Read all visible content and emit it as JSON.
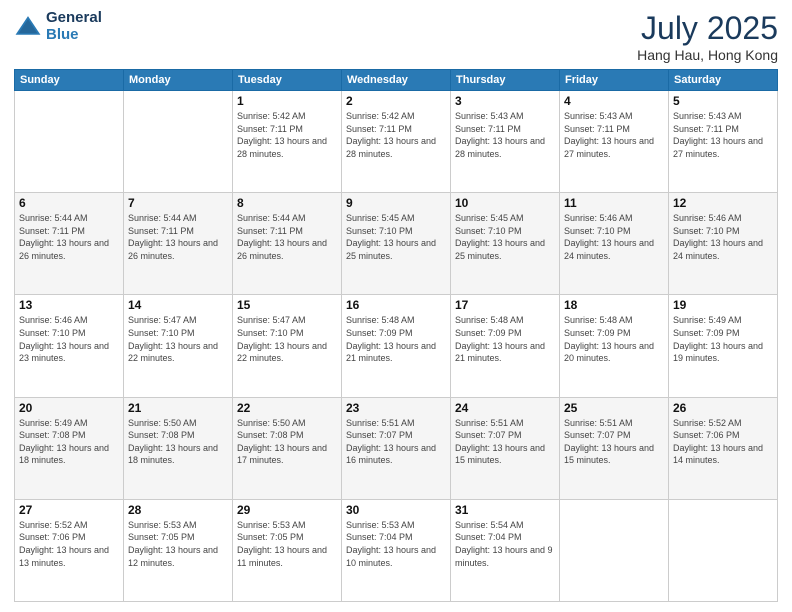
{
  "logo": {
    "general": "General",
    "blue": "Blue"
  },
  "title": {
    "month": "July 2025",
    "location": "Hang Hau, Hong Kong"
  },
  "weekdays": [
    "Sunday",
    "Monday",
    "Tuesday",
    "Wednesday",
    "Thursday",
    "Friday",
    "Saturday"
  ],
  "weeks": [
    [
      {
        "day": "",
        "info": ""
      },
      {
        "day": "",
        "info": ""
      },
      {
        "day": "1",
        "info": "Sunrise: 5:42 AM\nSunset: 7:11 PM\nDaylight: 13 hours and 28 minutes."
      },
      {
        "day": "2",
        "info": "Sunrise: 5:42 AM\nSunset: 7:11 PM\nDaylight: 13 hours and 28 minutes."
      },
      {
        "day": "3",
        "info": "Sunrise: 5:43 AM\nSunset: 7:11 PM\nDaylight: 13 hours and 28 minutes."
      },
      {
        "day": "4",
        "info": "Sunrise: 5:43 AM\nSunset: 7:11 PM\nDaylight: 13 hours and 27 minutes."
      },
      {
        "day": "5",
        "info": "Sunrise: 5:43 AM\nSunset: 7:11 PM\nDaylight: 13 hours and 27 minutes."
      }
    ],
    [
      {
        "day": "6",
        "info": "Sunrise: 5:44 AM\nSunset: 7:11 PM\nDaylight: 13 hours and 26 minutes."
      },
      {
        "day": "7",
        "info": "Sunrise: 5:44 AM\nSunset: 7:11 PM\nDaylight: 13 hours and 26 minutes."
      },
      {
        "day": "8",
        "info": "Sunrise: 5:44 AM\nSunset: 7:11 PM\nDaylight: 13 hours and 26 minutes."
      },
      {
        "day": "9",
        "info": "Sunrise: 5:45 AM\nSunset: 7:10 PM\nDaylight: 13 hours and 25 minutes."
      },
      {
        "day": "10",
        "info": "Sunrise: 5:45 AM\nSunset: 7:10 PM\nDaylight: 13 hours and 25 minutes."
      },
      {
        "day": "11",
        "info": "Sunrise: 5:46 AM\nSunset: 7:10 PM\nDaylight: 13 hours and 24 minutes."
      },
      {
        "day": "12",
        "info": "Sunrise: 5:46 AM\nSunset: 7:10 PM\nDaylight: 13 hours and 24 minutes."
      }
    ],
    [
      {
        "day": "13",
        "info": "Sunrise: 5:46 AM\nSunset: 7:10 PM\nDaylight: 13 hours and 23 minutes."
      },
      {
        "day": "14",
        "info": "Sunrise: 5:47 AM\nSunset: 7:10 PM\nDaylight: 13 hours and 22 minutes."
      },
      {
        "day": "15",
        "info": "Sunrise: 5:47 AM\nSunset: 7:10 PM\nDaylight: 13 hours and 22 minutes."
      },
      {
        "day": "16",
        "info": "Sunrise: 5:48 AM\nSunset: 7:09 PM\nDaylight: 13 hours and 21 minutes."
      },
      {
        "day": "17",
        "info": "Sunrise: 5:48 AM\nSunset: 7:09 PM\nDaylight: 13 hours and 21 minutes."
      },
      {
        "day": "18",
        "info": "Sunrise: 5:48 AM\nSunset: 7:09 PM\nDaylight: 13 hours and 20 minutes."
      },
      {
        "day": "19",
        "info": "Sunrise: 5:49 AM\nSunset: 7:09 PM\nDaylight: 13 hours and 19 minutes."
      }
    ],
    [
      {
        "day": "20",
        "info": "Sunrise: 5:49 AM\nSunset: 7:08 PM\nDaylight: 13 hours and 18 minutes."
      },
      {
        "day": "21",
        "info": "Sunrise: 5:50 AM\nSunset: 7:08 PM\nDaylight: 13 hours and 18 minutes."
      },
      {
        "day": "22",
        "info": "Sunrise: 5:50 AM\nSunset: 7:08 PM\nDaylight: 13 hours and 17 minutes."
      },
      {
        "day": "23",
        "info": "Sunrise: 5:51 AM\nSunset: 7:07 PM\nDaylight: 13 hours and 16 minutes."
      },
      {
        "day": "24",
        "info": "Sunrise: 5:51 AM\nSunset: 7:07 PM\nDaylight: 13 hours and 15 minutes."
      },
      {
        "day": "25",
        "info": "Sunrise: 5:51 AM\nSunset: 7:07 PM\nDaylight: 13 hours and 15 minutes."
      },
      {
        "day": "26",
        "info": "Sunrise: 5:52 AM\nSunset: 7:06 PM\nDaylight: 13 hours and 14 minutes."
      }
    ],
    [
      {
        "day": "27",
        "info": "Sunrise: 5:52 AM\nSunset: 7:06 PM\nDaylight: 13 hours and 13 minutes."
      },
      {
        "day": "28",
        "info": "Sunrise: 5:53 AM\nSunset: 7:05 PM\nDaylight: 13 hours and 12 minutes."
      },
      {
        "day": "29",
        "info": "Sunrise: 5:53 AM\nSunset: 7:05 PM\nDaylight: 13 hours and 11 minutes."
      },
      {
        "day": "30",
        "info": "Sunrise: 5:53 AM\nSunset: 7:04 PM\nDaylight: 13 hours and 10 minutes."
      },
      {
        "day": "31",
        "info": "Sunrise: 5:54 AM\nSunset: 7:04 PM\nDaylight: 13 hours and 9 minutes."
      },
      {
        "day": "",
        "info": ""
      },
      {
        "day": "",
        "info": ""
      }
    ]
  ]
}
